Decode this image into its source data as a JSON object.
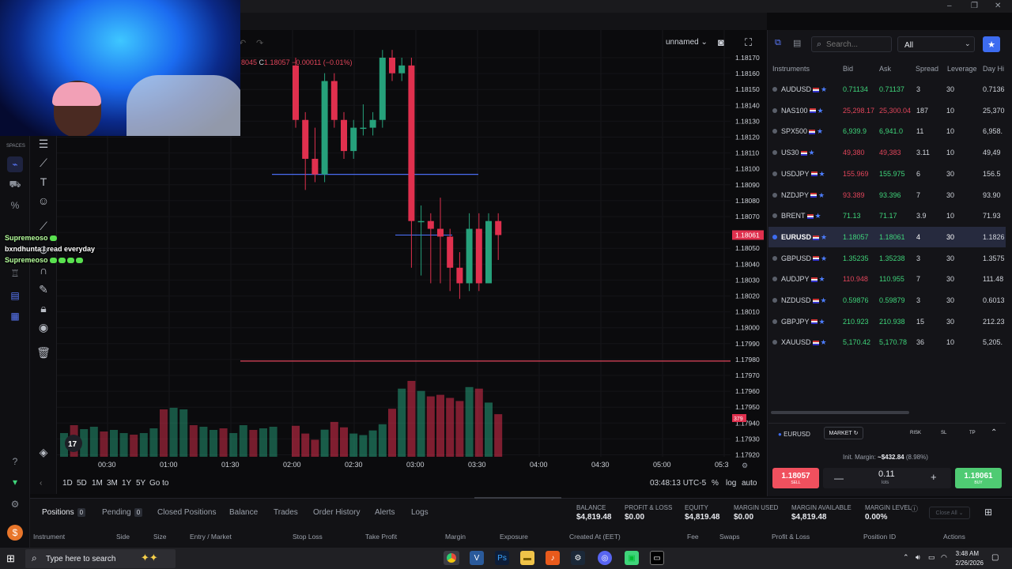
{
  "window": {
    "minimize": "–",
    "restore": "❐",
    "close": "✕"
  },
  "chart_header": {
    "layout_name": "unnamed",
    "ohlc_low": "8045",
    "ohlc_close_label": "C",
    "ohlc_close": "1.18057",
    "ohlc_change": "−0.00011 (−0.01%)"
  },
  "spaces_label": "SPACES",
  "chat": [
    {
      "user": "Supremeoso",
      "message": ""
    },
    {
      "user": "bxndhunta",
      "message": "I read everyday"
    },
    {
      "user": "Supremeoso",
      "message": ""
    }
  ],
  "price_axis": [
    "1.18170",
    "1.18160",
    "1.18150",
    "1.18140",
    "1.18130",
    "1.18120",
    "1.18110",
    "1.18100",
    "1.18090",
    "1.18080",
    "1.18070",
    "1.18061",
    "1.18050",
    "1.18040",
    "1.18030",
    "1.18020",
    "1.18010",
    "1.18000",
    "1.17990",
    "1.17980",
    "1.17970",
    "1.17960",
    "1.17950",
    "1.17940",
    "1.17930",
    "1.17920"
  ],
  "current_price": "1.18061",
  "volume_badge": "379",
  "time_axis": [
    "00:30",
    "01:00",
    "01:30",
    "02:00",
    "02:30",
    "03:00",
    "03:30",
    "04:00",
    "04:30",
    "05:00",
    "05:3"
  ],
  "timeframes": [
    "1D",
    "5D",
    "1M",
    "3M",
    "1Y",
    "5Y",
    "Go to"
  ],
  "clock": "03:48:13 UTC-5",
  "chart_opts": [
    "%",
    "log",
    "auto"
  ],
  "colors": {
    "up": "#26a17b",
    "down": "#e0304e",
    "accent": "#3d6cf0",
    "line_blue": "#4a6cf0",
    "line_red": "#e0455a"
  },
  "instruments_panel": {
    "search_placeholder": "Search...",
    "filter": "All",
    "headers": [
      "Instruments",
      "Bid",
      "Ask",
      "Spread",
      "Leverage",
      "Day Hi"
    ],
    "rows": [
      {
        "symbol": "AUDUSD",
        "bid": "0.71134",
        "ask": "0.71137",
        "spread": "3",
        "leverage": "30",
        "dayhi": "0.7136",
        "bid_color": "#3fd47a",
        "ask_color": "#3fd47a"
      },
      {
        "symbol": "NAS100",
        "bid": "25,298.17",
        "ask": "25,300.04",
        "spread": "187",
        "leverage": "10",
        "dayhi": "25,370",
        "bid_color": "#e0455a",
        "ask_color": "#e0455a"
      },
      {
        "symbol": "SPX500",
        "bid": "6,939.9",
        "ask": "6,941.0",
        "spread": "11",
        "leverage": "10",
        "dayhi": "6,958.",
        "bid_color": "#3fd47a",
        "ask_color": "#3fd47a"
      },
      {
        "symbol": "US30",
        "bid": "49,380",
        "ask": "49,383",
        "spread": "3.11",
        "leverage": "10",
        "dayhi": "49,49",
        "bid_color": "#e0455a",
        "ask_color": "#e0455a"
      },
      {
        "symbol": "USDJPY",
        "bid": "155.969",
        "ask": "155.975",
        "spread": "6",
        "leverage": "30",
        "dayhi": "156.5",
        "bid_color": "#e0455a",
        "ask_color": "#3fd47a"
      },
      {
        "symbol": "NZDJPY",
        "bid": "93.389",
        "ask": "93.396",
        "spread": "7",
        "leverage": "30",
        "dayhi": "93.90",
        "bid_color": "#e0455a",
        "ask_color": "#3fd47a"
      },
      {
        "symbol": "BRENT",
        "bid": "71.13",
        "ask": "71.17",
        "spread": "3.9",
        "leverage": "10",
        "dayhi": "71.93",
        "bid_color": "#3fd47a",
        "ask_color": "#3fd47a"
      },
      {
        "symbol": "EURUSD",
        "bid": "1.18057",
        "ask": "1.18061",
        "spread": "4",
        "leverage": "30",
        "dayhi": "1.1826",
        "bid_color": "#3fd47a",
        "ask_color": "#3fd47a",
        "selected": true
      },
      {
        "symbol": "GBPUSD",
        "bid": "1.35235",
        "ask": "1.35238",
        "spread": "3",
        "leverage": "30",
        "dayhi": "1.3575",
        "bid_color": "#3fd47a",
        "ask_color": "#3fd47a"
      },
      {
        "symbol": "AUDJPY",
        "bid": "110.948",
        "ask": "110.955",
        "spread": "7",
        "leverage": "30",
        "dayhi": "111.48",
        "bid_color": "#e0455a",
        "ask_color": "#3fd47a"
      },
      {
        "symbol": "NZDUSD",
        "bid": "0.59876",
        "ask": "0.59879",
        "spread": "3",
        "leverage": "30",
        "dayhi": "0.6013",
        "bid_color": "#3fd47a",
        "ask_color": "#3fd47a"
      },
      {
        "symbol": "GBPJPY",
        "bid": "210.923",
        "ask": "210.938",
        "spread": "15",
        "leverage": "30",
        "dayhi": "212.23",
        "bid_color": "#3fd47a",
        "ask_color": "#3fd47a"
      },
      {
        "symbol": "XAUUSD",
        "bid": "5,170.42",
        "ask": "5,170.78",
        "spread": "36",
        "leverage": "10",
        "dayhi": "5,205.",
        "bid_color": "#3fd47a",
        "ask_color": "#3fd47a"
      }
    ]
  },
  "order": {
    "symbol": "EURUSD",
    "type": "MARKET",
    "risk": "RISK",
    "sl": "SL",
    "tp": "TP",
    "margin_label": "Init. Margin:",
    "margin_value": "~$432.84",
    "margin_pct": "(8.98%)",
    "sell_price": "1.18057",
    "sell_label": "SELL",
    "buy_price": "1.18061",
    "buy_label": "BUY",
    "lots": "0.11",
    "lots_label": "lots",
    "minus": "—",
    "plus": "+"
  },
  "bottom_tabs": [
    {
      "label": "Positions",
      "count": "0",
      "active": true
    },
    {
      "label": "Pending",
      "count": "0"
    },
    {
      "label": "Closed Positions"
    },
    {
      "label": "Balance"
    },
    {
      "label": "Trades"
    },
    {
      "label": "Order History"
    },
    {
      "label": "Alerts"
    },
    {
      "label": "Logs"
    }
  ],
  "account": {
    "balance_label": "BALANCE",
    "balance": "$4,819.48",
    "pl_label": "PROFIT & LOSS",
    "pl": "$0.00",
    "equity_label": "EQUITY",
    "equity": "$4,819.48",
    "margin_used_label": "MARGIN USED",
    "margin_used": "$0.00",
    "margin_avail_label": "MARGIN AVAILABLE",
    "margin_avail": "$4,819.48",
    "margin_level_label": "MARGIN LEVEL",
    "margin_level": "0.00%",
    "close_all": "Close All"
  },
  "position_columns": [
    "Instrument",
    "Side",
    "Size",
    "Entry / Market",
    "Stop Loss",
    "Take Profit",
    "Margin",
    "Exposure",
    "Created At (EET)",
    "Fee",
    "Swaps",
    "Profit & Loss",
    "Position ID",
    "Actions"
  ],
  "taskbar": {
    "search_placeholder": "Type here to search",
    "time": "3:48 AM",
    "date": "2/26/2026"
  },
  "chart_data": {
    "type": "candlestick",
    "x": [
      "02:00",
      "02:05",
      "02:10",
      "02:15",
      "02:20",
      "02:25",
      "02:30",
      "02:35",
      "02:40",
      "02:45",
      "02:50",
      "02:55",
      "03:00",
      "03:05",
      "03:10",
      "03:15",
      "03:20",
      "03:25",
      "03:30",
      "03:35",
      "03:40",
      "03:45"
    ],
    "open": [
      1.1817,
      1.18135,
      1.1811,
      1.181,
      1.1816,
      1.18135,
      1.18115,
      1.1813,
      1.1813,
      1.18135,
      1.18175,
      1.18165,
      1.1817,
      1.1807,
      1.1807,
      1.18065,
      1.1806,
      1.1804,
      1.1803,
      1.18065,
      1.1803,
      1.1807
    ],
    "close": [
      1.18135,
      1.1811,
      1.181,
      1.1816,
      1.18135,
      1.18115,
      1.1813,
      1.1813,
      1.18135,
      1.18175,
      1.18165,
      1.1817,
      1.1807,
      1.1807,
      1.18065,
      1.1806,
      1.1804,
      1.1803,
      1.18065,
      1.1803,
      1.1807,
      1.18061
    ],
    "high": [
      1.18175,
      1.1814,
      1.1813,
      1.18165,
      1.18165,
      1.1814,
      1.18135,
      1.18145,
      1.1814,
      1.1818,
      1.1818,
      1.18175,
      1.18175,
      1.1808,
      1.18075,
      1.18085,
      1.18065,
      1.1805,
      1.18075,
      1.18075,
      1.18075,
      1.18075
    ],
    "low": [
      1.1813,
      1.1809,
      1.18095,
      1.18095,
      1.1813,
      1.1811,
      1.1811,
      1.18125,
      1.18125,
      1.1813,
      1.1816,
      1.1816,
      1.1804,
      1.18035,
      1.1803,
      1.1803,
      1.18025,
      1.1802,
      1.18025,
      1.18025,
      1.1803,
      1.18045
    ],
    "volume": [
      40,
      30,
      22,
      35,
      45,
      38,
      30,
      28,
      34,
      42,
      62,
      88,
      98,
      85,
      78,
      80,
      76,
      72,
      90,
      88,
      70,
      55
    ],
    "ylim": [
      1.1792,
      1.18175
    ],
    "hlines": [
      1.181,
      1.18061,
      1.1798
    ]
  }
}
